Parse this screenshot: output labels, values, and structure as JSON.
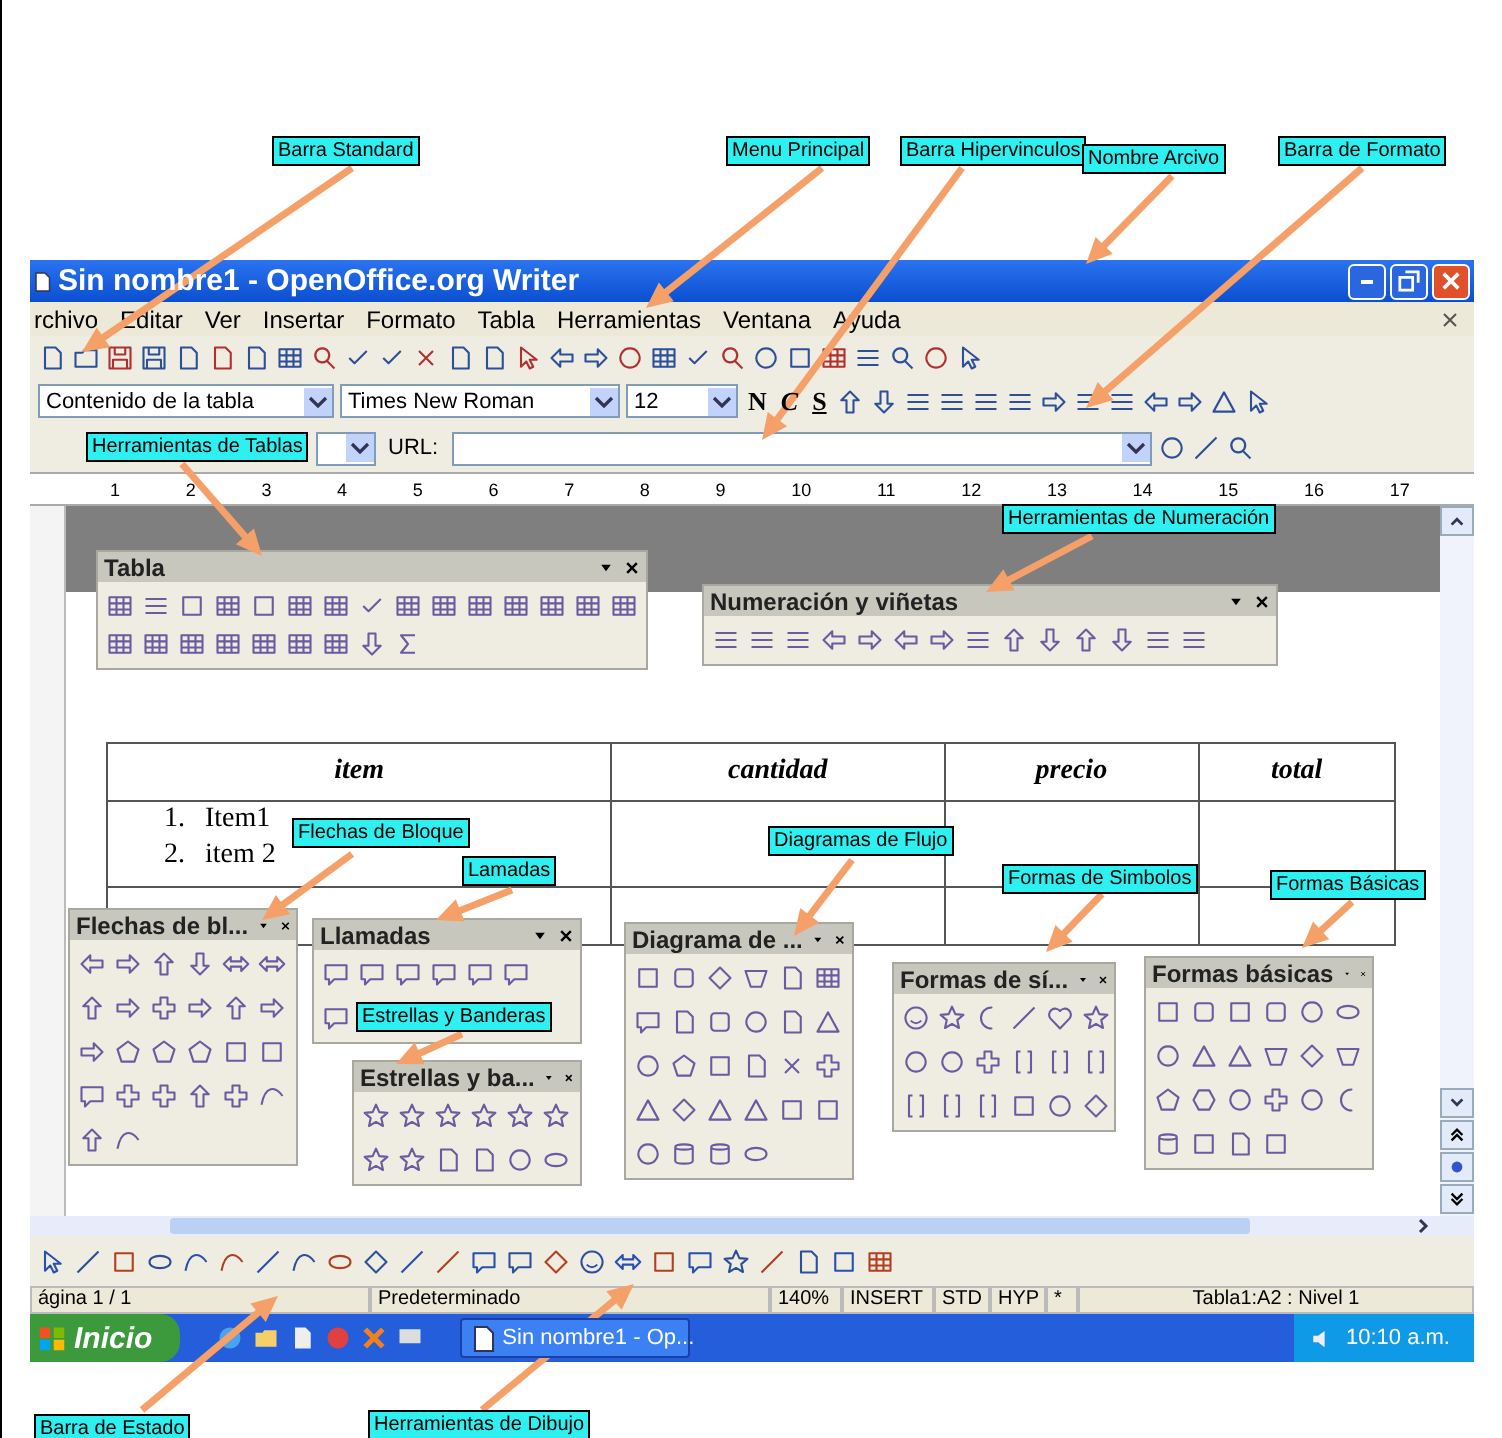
{
  "callouts": [
    {
      "text": "Barra Standard"
    },
    {
      "text": "Menu Principal"
    },
    {
      "text": "Barra Hipervinculos"
    },
    {
      "text": "Nombre Arcivo"
    },
    {
      "text": "Barra de Formato"
    },
    {
      "text": "Herramientas de Tablas"
    },
    {
      "text": "Herramientas de Numeración"
    },
    {
      "text": "Flechas de Bloque"
    },
    {
      "text": "Lamadas"
    },
    {
      "text": "Diagramas de Flujo"
    },
    {
      "text": "Formas de Simbolos"
    },
    {
      "text": "Formas Básicas"
    },
    {
      "text": "Estrellas y Banderas"
    },
    {
      "text": "Barra de Estado"
    },
    {
      "text": "Herramientas de Dibujo"
    }
  ],
  "window": {
    "title": "Sin nombre1 - OpenOffice.org Writer"
  },
  "menu": [
    {
      "label": "rchivo"
    },
    {
      "label": "Editar"
    },
    {
      "label": "Ver"
    },
    {
      "label": "Insertar"
    },
    {
      "label": "Formato"
    },
    {
      "label": "Tabla"
    },
    {
      "label": "Herramientas"
    },
    {
      "label": "Ventana"
    },
    {
      "label": "Ayuda"
    }
  ],
  "format_bar": {
    "style": "Contenido de la tabla",
    "font": "Times New Roman",
    "size": "12",
    "buttons": [
      "N",
      "C",
      "S"
    ]
  },
  "hyperlink_bar": {
    "label": "URL:"
  },
  "ruler": [
    "1",
    "2",
    "3",
    "4",
    "5",
    "6",
    "7",
    "8",
    "9",
    "10",
    "11",
    "12",
    "13",
    "14",
    "15",
    "16",
    "17"
  ],
  "table": {
    "columns": [
      "item",
      "cantidad",
      "precio",
      "total"
    ],
    "list": [
      {
        "number": "1.",
        "text": "Item1"
      },
      {
        "number": "2.",
        "text": "item 2"
      }
    ]
  },
  "palettes": [
    {
      "title": "Tabla"
    },
    {
      "title": "Numeración y viñetas"
    },
    {
      "title": "Flechas de bl..."
    },
    {
      "title": "Llamadas"
    },
    {
      "title": "Estrellas y ba..."
    },
    {
      "title": "Diagrama de ..."
    },
    {
      "title": "Formas de sí..."
    },
    {
      "title": "Formas básicas"
    }
  ],
  "status_bar": [
    "ágina 1 / 1",
    "Predeterminado",
    "140%",
    "INSERT",
    "STD",
    "HYP",
    "*",
    "Tabla1:A2 : Nivel 1"
  ],
  "taskbar": {
    "start": "Inicio",
    "task": "Sin nombre1 - Op...",
    "clock": "10:10 a.m."
  }
}
